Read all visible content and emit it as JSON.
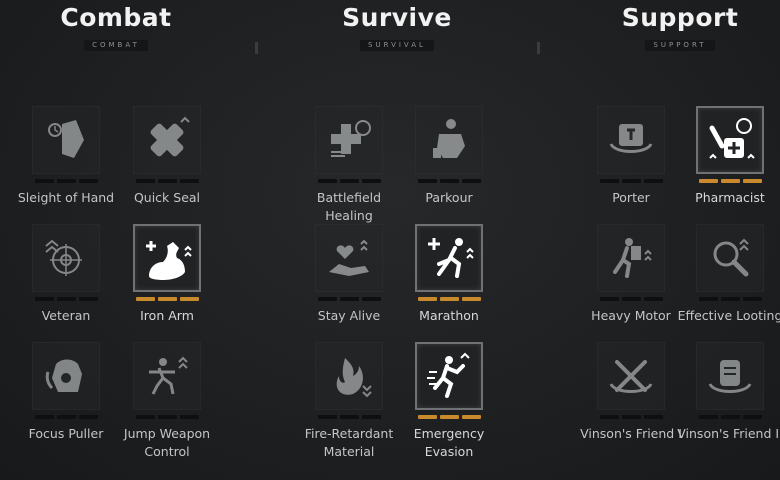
{
  "categories": [
    {
      "title": "Combat",
      "subtitle": "COMBAT"
    },
    {
      "title": "Survive",
      "subtitle": "SURVIVAL"
    },
    {
      "title": "Support",
      "subtitle": "SUPPORT"
    }
  ],
  "perks": [
    {
      "label": "Sleight of Hand",
      "icon": "sleight-of-hand-icon",
      "active": false
    },
    {
      "label": "Quick Seal",
      "icon": "quick-seal-icon",
      "active": false
    },
    {
      "label": "Veteran",
      "icon": "veteran-icon",
      "active": false
    },
    {
      "label": "Iron Arm",
      "icon": "iron-arm-icon",
      "active": true
    },
    {
      "label": "Focus Puller",
      "icon": "focus-puller-icon",
      "active": false
    },
    {
      "label": "Jump Weapon Control",
      "icon": "jump-weapon-control-icon",
      "active": false
    },
    {
      "label": "Battlefield Healing",
      "icon": "battlefield-healing-icon",
      "active": false
    },
    {
      "label": "Parkour",
      "icon": "parkour-icon",
      "active": false
    },
    {
      "label": "Stay Alive",
      "icon": "stay-alive-icon",
      "active": false
    },
    {
      "label": "Marathon",
      "icon": "marathon-icon",
      "active": true
    },
    {
      "label": "Fire-Retardant Material",
      "icon": "fire-retardant-material-icon",
      "active": false
    },
    {
      "label": "Emergency Evasion",
      "icon": "emergency-evasion-icon",
      "active": true
    },
    {
      "label": "Porter",
      "icon": "porter-icon",
      "active": false
    },
    {
      "label": "Pharmacist",
      "icon": "pharmacist-icon",
      "active": true
    },
    {
      "label": "Heavy Motor",
      "icon": "heavy-motor-icon",
      "active": false
    },
    {
      "label": "Effective Looting",
      "icon": "effective-looting-icon",
      "active": false
    },
    {
      "label": "Vinson's Friend I",
      "icon": "vinsons-friend-i-icon",
      "active": false
    },
    {
      "label": "Vinson's Friend II",
      "icon": "vinsons-friend-ii-icon",
      "active": false
    }
  ],
  "colors": {
    "active_bar": "#c98a2e",
    "inactive_bar": "#0e0f10",
    "title": "#f2f2f2"
  }
}
